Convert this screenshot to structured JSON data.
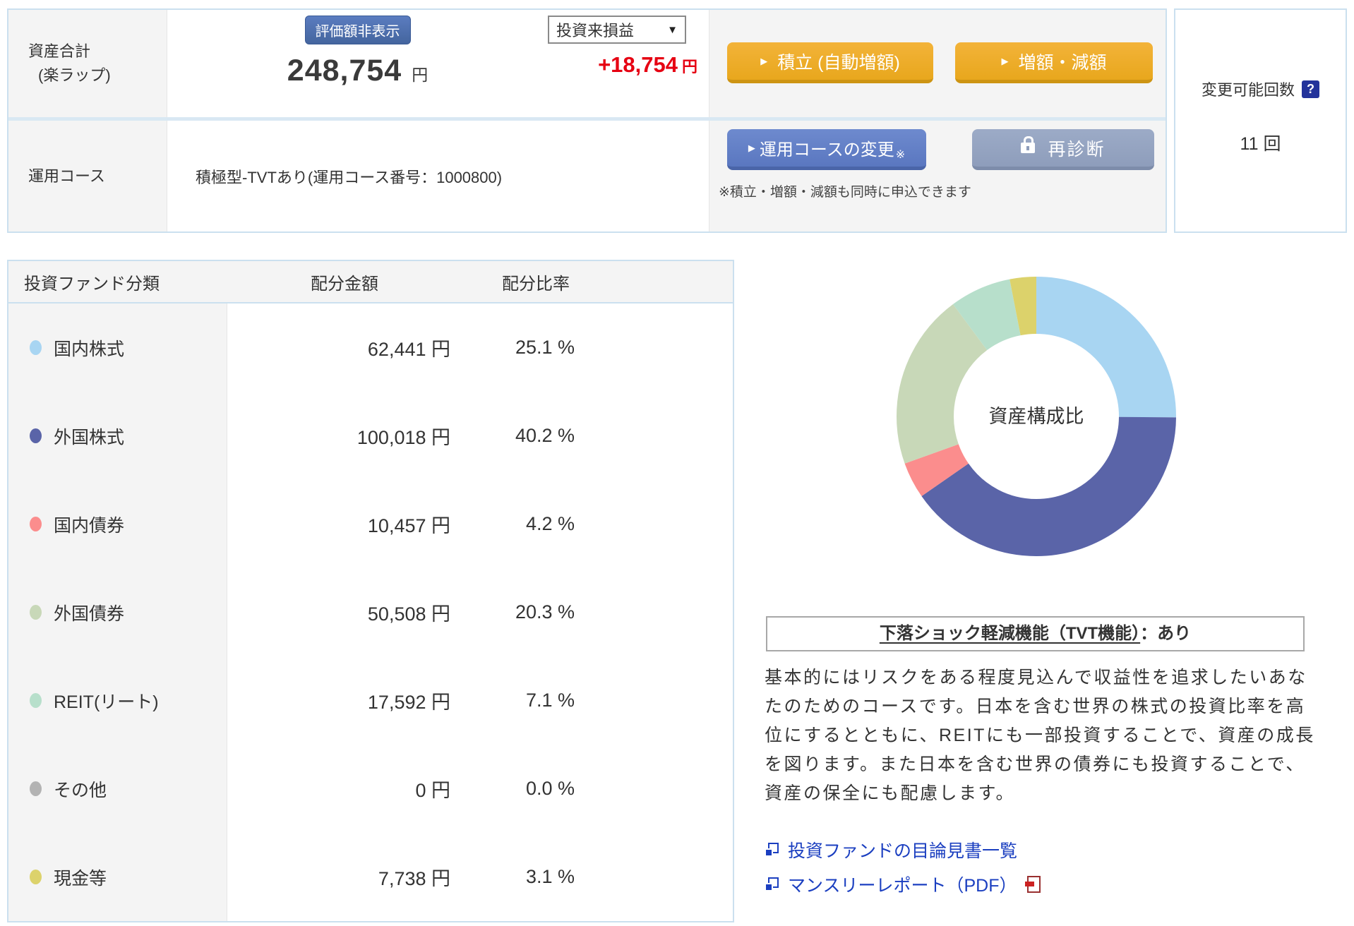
{
  "summary": {
    "asset_label_line1": "資産合計",
    "asset_label_line2": "(楽ラップ)",
    "hide_badge": "評価額非表示",
    "total_value": "248,754",
    "total_unit": "円",
    "pl_select": "投資来損益",
    "pl_select_arrow": "▼",
    "pl_value": "+18,754",
    "pl_unit": "円",
    "btn_tsumitate": "積立 (自動増額)",
    "btn_zogaku": "増額・減額",
    "course_label": "運用コース",
    "course_value": "積極型-TVTあり(運用コース番号：1000800)",
    "btn_course_change": "運用コースの変更",
    "btn_course_change_mark": "※",
    "btn_rediagnosis": "再診断",
    "note": "※積立・増額・減額も同時に申込できます",
    "changes": {
      "label": "変更可能回数",
      "help": "?",
      "value": "11 回"
    }
  },
  "table": {
    "headers": [
      "投資ファンド分類",
      "配分金額",
      "配分比率"
    ],
    "rows": [
      {
        "label": "国内株式",
        "color": "#a8d5f2",
        "amount": "62,441 円",
        "ratio": "25.1 %"
      },
      {
        "label": "外国株式",
        "color": "#5a64a8",
        "amount": "100,018 円",
        "ratio": "40.2 %"
      },
      {
        "label": "国内債券",
        "color": "#fb8d8d",
        "amount": "10,457 円",
        "ratio": "4.2 %"
      },
      {
        "label": "外国債券",
        "color": "#c8d8b8",
        "amount": "50,508 円",
        "ratio": "20.3 %"
      },
      {
        "label": "REIT(リート)",
        "color": "#b7dfcb",
        "amount": "17,592 円",
        "ratio": "7.1 %"
      },
      {
        "label": "その他",
        "color": "#b3b3b3",
        "amount": "0 円",
        "ratio": "0.0 %"
      },
      {
        "label": "現金等",
        "color": "#dcd26b",
        "amount": "7,738 円",
        "ratio": "3.1 %"
      }
    ]
  },
  "chart_data": {
    "type": "pie",
    "donut": true,
    "center_label": "資産構成比",
    "categories": [
      "国内株式",
      "外国株式",
      "国内債券",
      "外国債券",
      "REIT(リート)",
      "その他",
      "現金等"
    ],
    "values": [
      25.1,
      40.2,
      4.2,
      20.3,
      7.1,
      0.0,
      3.1
    ],
    "colors": [
      "#a8d5f2",
      "#5a64a8",
      "#fb8d8d",
      "#c8d8b8",
      "#b7dfcb",
      "#b3b3b3",
      "#dcd26b"
    ],
    "unit": "%",
    "legend_position": "none"
  },
  "tvt": {
    "title_underlined": "下落ショック軽減機能（TVT機能）",
    "title_suffix": "：あり"
  },
  "description": "基本的にはリスクをある程度見込んで収益性を追求したいあなたのためのコースです。日本を含む世界の株式の投資比率を高位にするとともに、REITにも一部投資することで、資産の成長を図ります。また日本を含む世界の債券にも投資することで、資産の保全にも配慮します。",
  "links": [
    {
      "label": "投資ファンドの目論見書一覧"
    },
    {
      "label": "マンスリーレポート（PDF）"
    }
  ],
  "colors": {
    "accent_border": "#cbe0ef",
    "panel_gray": "#f4f4f4",
    "profit_red": "#e60012",
    "link_blue": "#1b3fc0",
    "button_orange": "#e8a71d",
    "button_blue": "#5a77c0",
    "button_gray": "#8e9dbb",
    "badge_blue": "#44659e"
  }
}
